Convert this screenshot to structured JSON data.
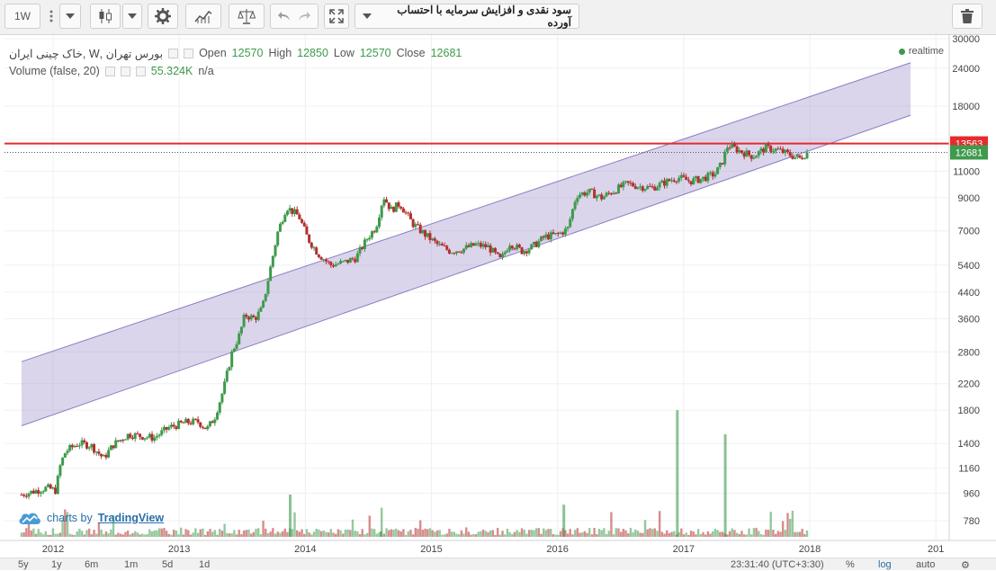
{
  "toolbar": {
    "interval": "1W",
    "symbol_title": "سود نقدی و افزایش سرمایه با احتساب آورده",
    "icons": [
      "more-icon",
      "dropdown-icon",
      "candles-icon",
      "dropdown-icon",
      "gear-icon",
      "indicators-icon",
      "compare-icon",
      "undo-icon",
      "redo-icon",
      "fullscreen-icon",
      "trash-icon"
    ]
  },
  "legend": {
    "symbol": "بورس تهران ,W ,خاک چینی ایران",
    "open_label": "Open",
    "open": "12570",
    "high_label": "High",
    "high": "12850",
    "low_label": "Low",
    "low": "12570",
    "close_label": "Close",
    "close": "12681",
    "volume_label": "Volume (false, 20)",
    "volume_value": "55.324K",
    "volume_na": "n/a",
    "realtime": "realtime"
  },
  "brand": {
    "prefix": "charts by",
    "name": "TradingView"
  },
  "bottom": {
    "ranges": [
      "5y",
      "1y",
      "6m",
      "1m",
      "5d",
      "1d"
    ],
    "time": "23:31:40 (UTC+3:30)",
    "options": [
      "%",
      "log",
      "auto"
    ]
  },
  "colors": {
    "up": "#3e9a4c",
    "down": "#b33030",
    "channel": "#8e7cc3",
    "hline": "#e52b2b"
  },
  "chart_data": {
    "type": "candlestick",
    "x_ticks": [
      "2012",
      "2013",
      "2014",
      "2015",
      "2016",
      "2017",
      "2018",
      "201"
    ],
    "y_ticks": [
      780,
      960,
      1160,
      1400,
      1800,
      2200,
      2800,
      3600,
      4400,
      5400,
      7000,
      9000,
      11000,
      14000,
      18000,
      24000,
      30000
    ],
    "y_scale": "log",
    "price_labels": {
      "horizontal_line": "13563",
      "last": "12681"
    },
    "channel_upper": [
      [
        2011.75,
        2600
      ],
      [
        2018.8,
        25000
      ]
    ],
    "channel_lower": [
      [
        2011.75,
        1600
      ],
      [
        2018.8,
        16800
      ]
    ],
    "horizontal_line": 13563,
    "price_path": [
      [
        2011.75,
        950
      ],
      [
        2011.95,
        1000
      ],
      [
        2012.02,
        980
      ],
      [
        2012.06,
        1200
      ],
      [
        2012.1,
        1320
      ],
      [
        2012.2,
        1400
      ],
      [
        2012.3,
        1380
      ],
      [
        2012.4,
        1250
      ],
      [
        2012.48,
        1390
      ],
      [
        2012.6,
        1500
      ],
      [
        2012.7,
        1480
      ],
      [
        2012.8,
        1460
      ],
      [
        2012.92,
        1580
      ],
      [
        2013.05,
        1640
      ],
      [
        2013.15,
        1650
      ],
      [
        2013.22,
        1560
      ],
      [
        2013.28,
        1700
      ],
      [
        2013.35,
        2100
      ],
      [
        2013.42,
        2800
      ],
      [
        2013.48,
        3200
      ],
      [
        2013.52,
        3700
      ],
      [
        2013.6,
        3600
      ],
      [
        2013.66,
        3900
      ],
      [
        2013.72,
        5200
      ],
      [
        2013.78,
        6900
      ],
      [
        2013.85,
        8400
      ],
      [
        2013.95,
        7800
      ],
      [
        2014.02,
        6600
      ],
      [
        2014.1,
        5900
      ],
      [
        2014.2,
        5400
      ],
      [
        2014.3,
        5500
      ],
      [
        2014.4,
        5700
      ],
      [
        2014.5,
        6700
      ],
      [
        2014.56,
        7200
      ],
      [
        2014.62,
        9100
      ],
      [
        2014.68,
        8200
      ],
      [
        2014.75,
        8600
      ],
      [
        2014.85,
        7400
      ],
      [
        2014.95,
        6800
      ],
      [
        2015.05,
        6300
      ],
      [
        2015.15,
        6000
      ],
      [
        2015.25,
        6100
      ],
      [
        2015.35,
        6300
      ],
      [
        2015.45,
        6200
      ],
      [
        2015.55,
        5600
      ],
      [
        2015.62,
        6400
      ],
      [
        2015.72,
        6000
      ],
      [
        2015.8,
        6200
      ],
      [
        2015.9,
        6700
      ],
      [
        2016.0,
        6800
      ],
      [
        2016.08,
        7100
      ],
      [
        2016.15,
        9200
      ],
      [
        2016.25,
        9400
      ],
      [
        2016.35,
        9000
      ],
      [
        2016.45,
        9500
      ],
      [
        2016.55,
        10000
      ],
      [
        2016.65,
        9800
      ],
      [
        2016.75,
        9700
      ],
      [
        2016.85,
        10100
      ],
      [
        2016.95,
        10500
      ],
      [
        2017.05,
        10200
      ],
      [
        2017.15,
        10400
      ],
      [
        2017.25,
        10800
      ],
      [
        2017.3,
        11600
      ],
      [
        2017.35,
        13400
      ],
      [
        2017.45,
        12800
      ],
      [
        2017.55,
        12300
      ],
      [
        2017.65,
        13100
      ],
      [
        2017.75,
        12900
      ],
      [
        2017.85,
        12400
      ],
      [
        2017.92,
        12100
      ],
      [
        2017.98,
        12681
      ]
    ],
    "volume_spikes": [
      [
        2013.88,
        950
      ],
      [
        2014.6,
        720
      ],
      [
        2016.05,
        880
      ],
      [
        2016.95,
        1800
      ],
      [
        2017.33,
        1500
      ]
    ]
  }
}
